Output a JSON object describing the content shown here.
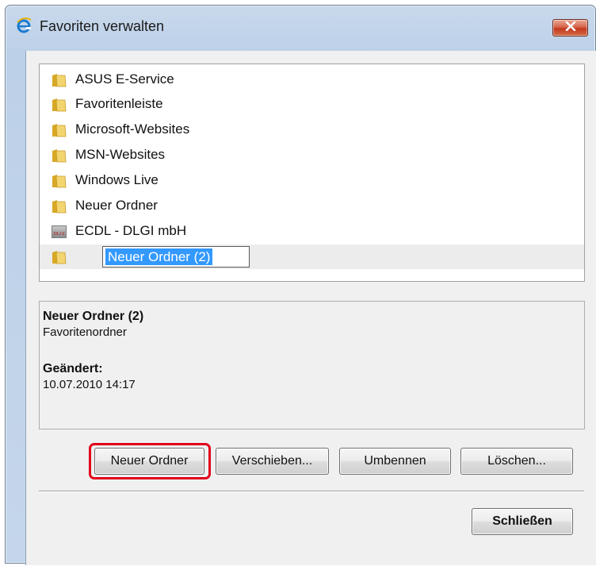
{
  "window": {
    "title": "Favoriten verwalten",
    "close_label": "Schließen"
  },
  "tree": {
    "items": [
      {
        "label": "ASUS E-Service",
        "icon": "folder-icon"
      },
      {
        "label": "Favoritenleiste",
        "icon": "folder-icon"
      },
      {
        "label": "Microsoft-Websites",
        "icon": "folder-icon"
      },
      {
        "label": "MSN-Websites",
        "icon": "folder-icon"
      },
      {
        "label": "Windows Live",
        "icon": "folder-icon"
      },
      {
        "label": "Neuer Ordner",
        "icon": "folder-icon"
      },
      {
        "label": "ECDL - DLGI mbH",
        "icon": "dlgi-favicon-icon",
        "icon_text": "DLGI"
      },
      {
        "label": "Neuer Ordner (2)",
        "icon": "folder-icon",
        "editing": true
      }
    ]
  },
  "details": {
    "name": "Neuer Ordner (2)",
    "type": "Favoritenordner",
    "modified_label": "Geändert:",
    "modified_value": "10.07.2010 14:17"
  },
  "buttons": {
    "new_folder": "Neuer Ordner",
    "move": "Verschieben...",
    "rename": "Umbennen",
    "delete": "Löschen...",
    "close": "Schließen"
  },
  "colors": {
    "highlight": "#e2001a",
    "selection": "#3399ff"
  }
}
